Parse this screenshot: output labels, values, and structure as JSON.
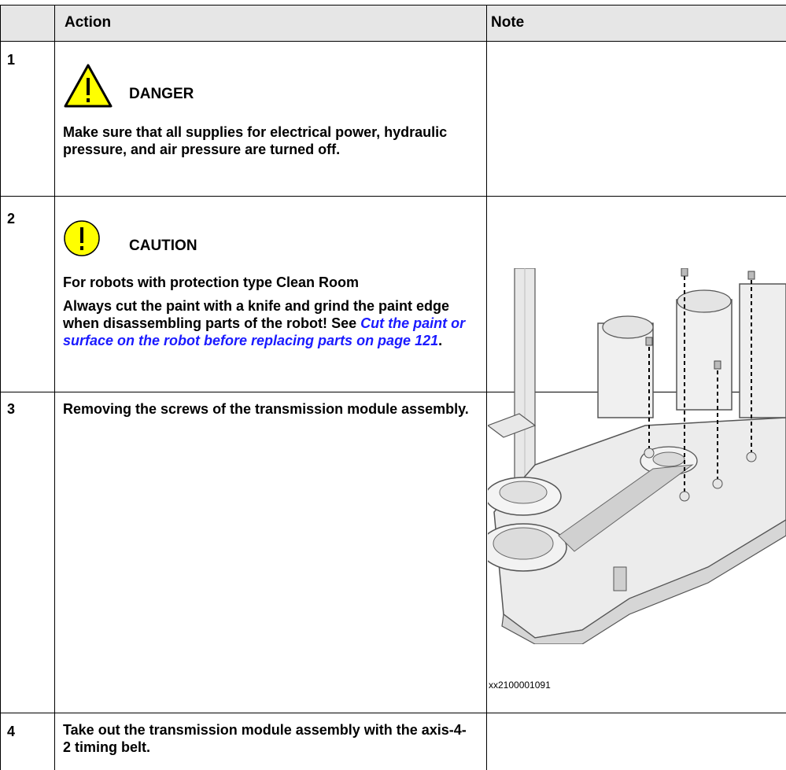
{
  "table": {
    "headers": {
      "step": "",
      "action": "Action",
      "note": "Note"
    },
    "rows": [
      {
        "num": "1",
        "symbol": {
          "icon": "danger-triangle-icon",
          "label": "DANGER",
          "color": "#ffff00"
        },
        "text": "Make sure that all supplies for electrical power, hydraulic pressure, and air pressure are turned off."
      },
      {
        "num": "2",
        "symbol": {
          "icon": "caution-circle-icon",
          "label": "CAUTION",
          "color": "#ffff00"
        },
        "heading": "For robots with protection type Clean Room",
        "text": "Always cut the paint with a knife and grind the paint edge when disassembling parts of the robot!",
        "see_prefix": "See ",
        "link": "Cut the paint or surface on the robot before replacing parts on page 121",
        "see_suffix": "."
      },
      {
        "num": "3",
        "text": "Removing the screws of the transmission module assembly.",
        "figure": {
          "icon": "transmission-module-illustration",
          "caption": "xx2100001091"
        }
      },
      {
        "num": "4",
        "text": "Take out the transmission module assembly with the axis-4-2 timing belt."
      }
    ]
  }
}
